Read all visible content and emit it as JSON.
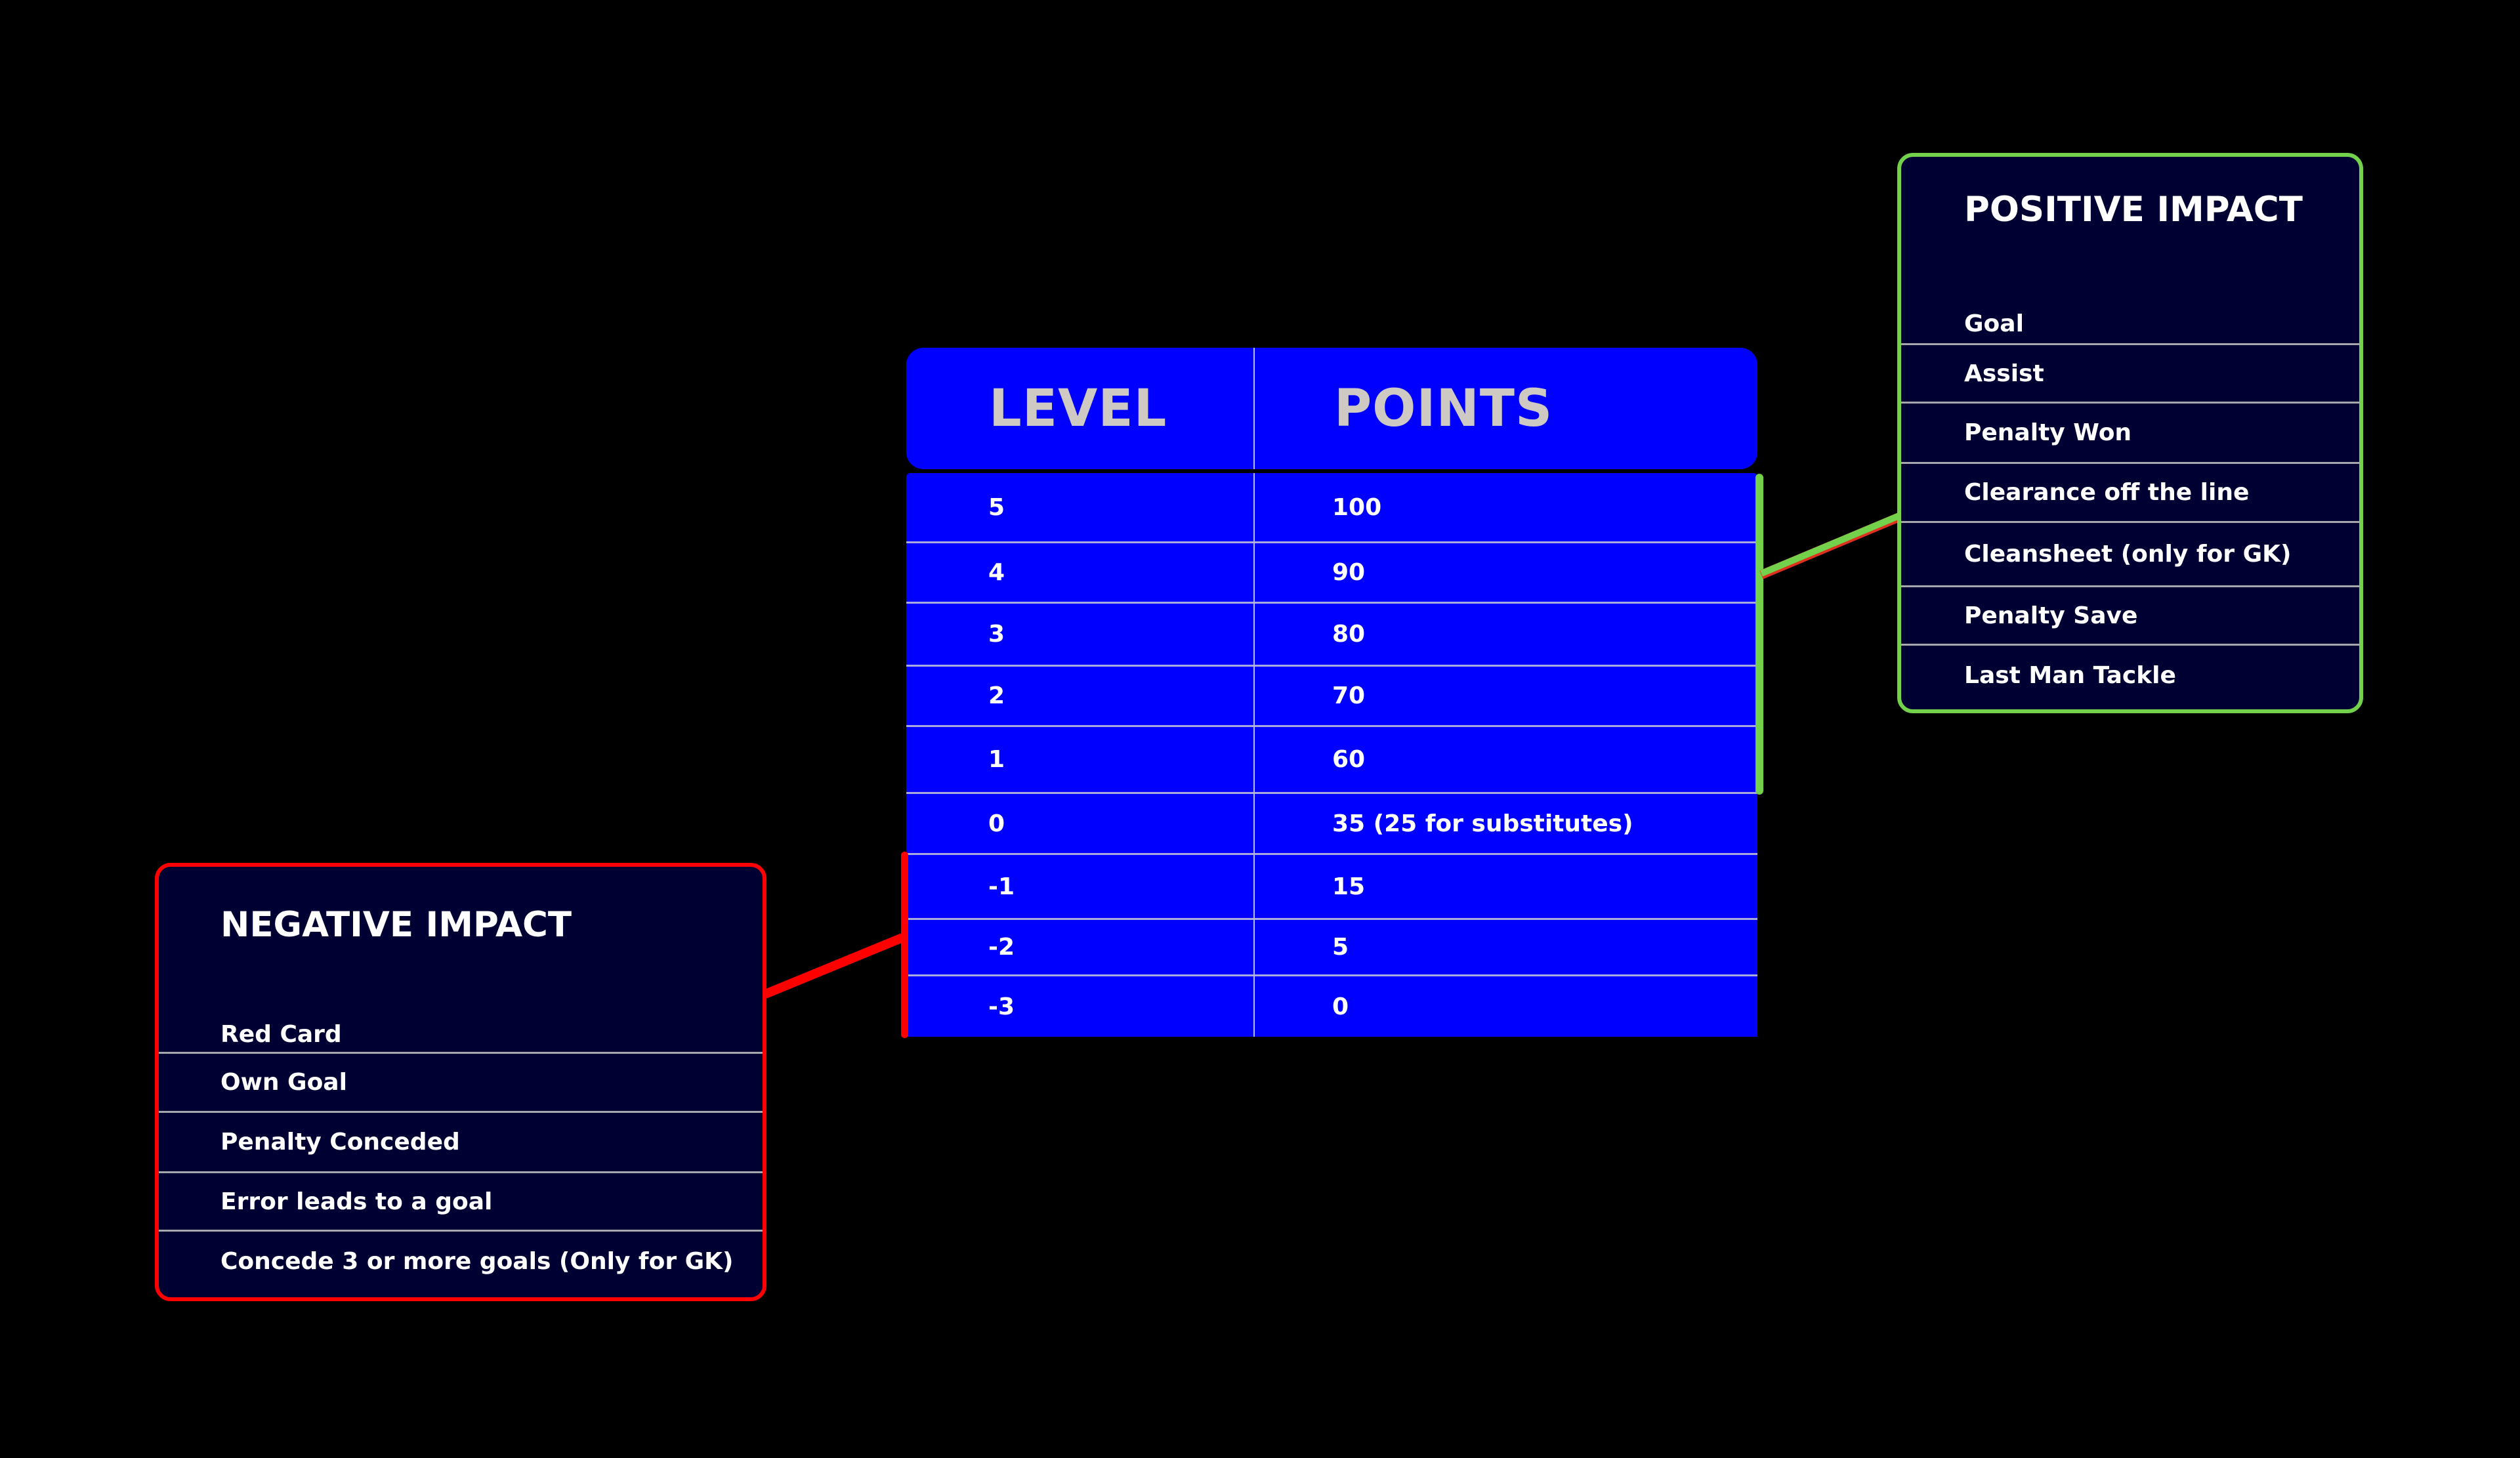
{
  "table": {
    "headers": {
      "level": "LEVEL",
      "points": "POINTS"
    },
    "rows": [
      {
        "level": "5",
        "points": "100"
      },
      {
        "level": "4",
        "points": "90"
      },
      {
        "level": "3",
        "points": "80"
      },
      {
        "level": "2",
        "points": "70"
      },
      {
        "level": "1",
        "points": "60"
      },
      {
        "level": "0",
        "points": "35 (25 for substitutes)"
      },
      {
        "level": "-1",
        "points": "15"
      },
      {
        "level": "-2",
        "points": "5"
      },
      {
        "level": "-3",
        "points": "0"
      }
    ]
  },
  "positive_impact": {
    "title": "POSITIVE IMPACT",
    "applies_to_levels": [
      "5",
      "4",
      "3",
      "2",
      "1"
    ],
    "items": [
      "Goal",
      "Assist",
      "Penalty Won",
      "Clearance off the line",
      "Cleansheet (only for GK)",
      "Penalty Save",
      "Last Man Tackle"
    ]
  },
  "negative_impact": {
    "title": "NEGATIVE IMPACT",
    "applies_to_levels": [
      "-1",
      "-2",
      "-3"
    ],
    "items": [
      "Red Card",
      "Own Goal",
      "Penalty Conceded",
      "Error leads to a goal",
      "Concede 3 or more goals (Only for GK)"
    ]
  },
  "colors": {
    "background": "#000000",
    "table_fill": "#0000ff",
    "header_text": "#cfc9c3",
    "box_fill": "#000033",
    "positive_accent": "#74d14c",
    "negative_accent": "#ff0000"
  }
}
